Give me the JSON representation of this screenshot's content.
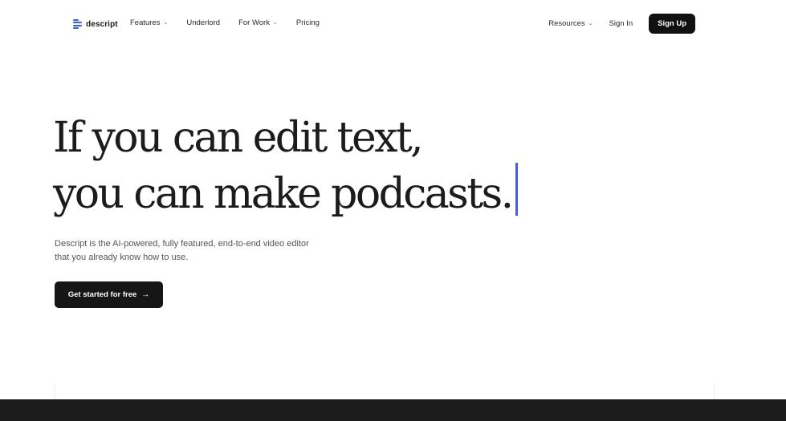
{
  "nav": {
    "brand": "descript",
    "links": [
      {
        "label": "Features",
        "has_dropdown": true
      },
      {
        "label": "Underlord",
        "has_dropdown": false
      },
      {
        "label": "For Work",
        "has_dropdown": true
      },
      {
        "label": "Pricing",
        "has_dropdown": false
      }
    ],
    "resources_label": "Resources",
    "sign_in_label": "Sign In",
    "sign_up_label": "Sign Up"
  },
  "hero": {
    "title_line1": "If you can edit text,",
    "title_line2": "you can make podcasts.",
    "subtitle_line1": "Descript is the AI-powered, fully featured, end-to-end video editor",
    "subtitle_line2": "that you already know how to use.",
    "cta_label": "Get started for free"
  },
  "icons": {
    "chevron": "chevron-down-icon",
    "arrow": "arrow-right-icon",
    "logo": "descript-logo-icon"
  },
  "colors": {
    "accent": "#4a5cd8",
    "logo_mark": "#3c5bd6",
    "button_bg": "#111111",
    "band": "#1b1b1b"
  }
}
